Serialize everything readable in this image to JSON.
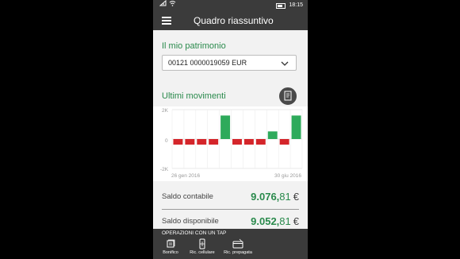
{
  "status_bar": {
    "time": "18:15"
  },
  "app_bar": {
    "title": "Quadro riassuntivo"
  },
  "patrimonio": {
    "title": "Il mio patrimonio",
    "account_selected": "00121 0000019059 EUR"
  },
  "movimenti": {
    "title": "Ultimi movimenti",
    "export_icon": "document-icon"
  },
  "chart_data": {
    "type": "bar",
    "y_ticks": [
      "2K",
      "0",
      "-2K"
    ],
    "x_labels": {
      "start": "26 gen 2016",
      "end": "30 giu 2016"
    },
    "ylim": [
      -2000,
      2000
    ],
    "values": [
      -380,
      -380,
      -380,
      -380,
      1600,
      -380,
      -380,
      -380,
      520,
      -380,
      1600
    ],
    "colors": {
      "positive": "#2eaa5b",
      "negative": "#d4252a"
    },
    "grid": true
  },
  "saldi": {
    "contabile": {
      "label": "Saldo contabile",
      "int": "9.076,",
      "dec": "81",
      "currency": "€"
    },
    "disponibile": {
      "label": "Saldo disponibile",
      "int": "9.052,",
      "dec": "81",
      "currency": "€"
    }
  },
  "operazioni": {
    "title": "OPERAZIONI CON UN TAP",
    "items": [
      {
        "label": "Bonifico",
        "icon": "transfer-icon"
      },
      {
        "label": "Ric. cellulare",
        "icon": "phone-topup-icon"
      },
      {
        "label": "Ric. prepagata",
        "icon": "card-topup-icon"
      }
    ]
  },
  "colors": {
    "accent": "#2a8a4c",
    "bar_bg": "#3b3b3b"
  }
}
